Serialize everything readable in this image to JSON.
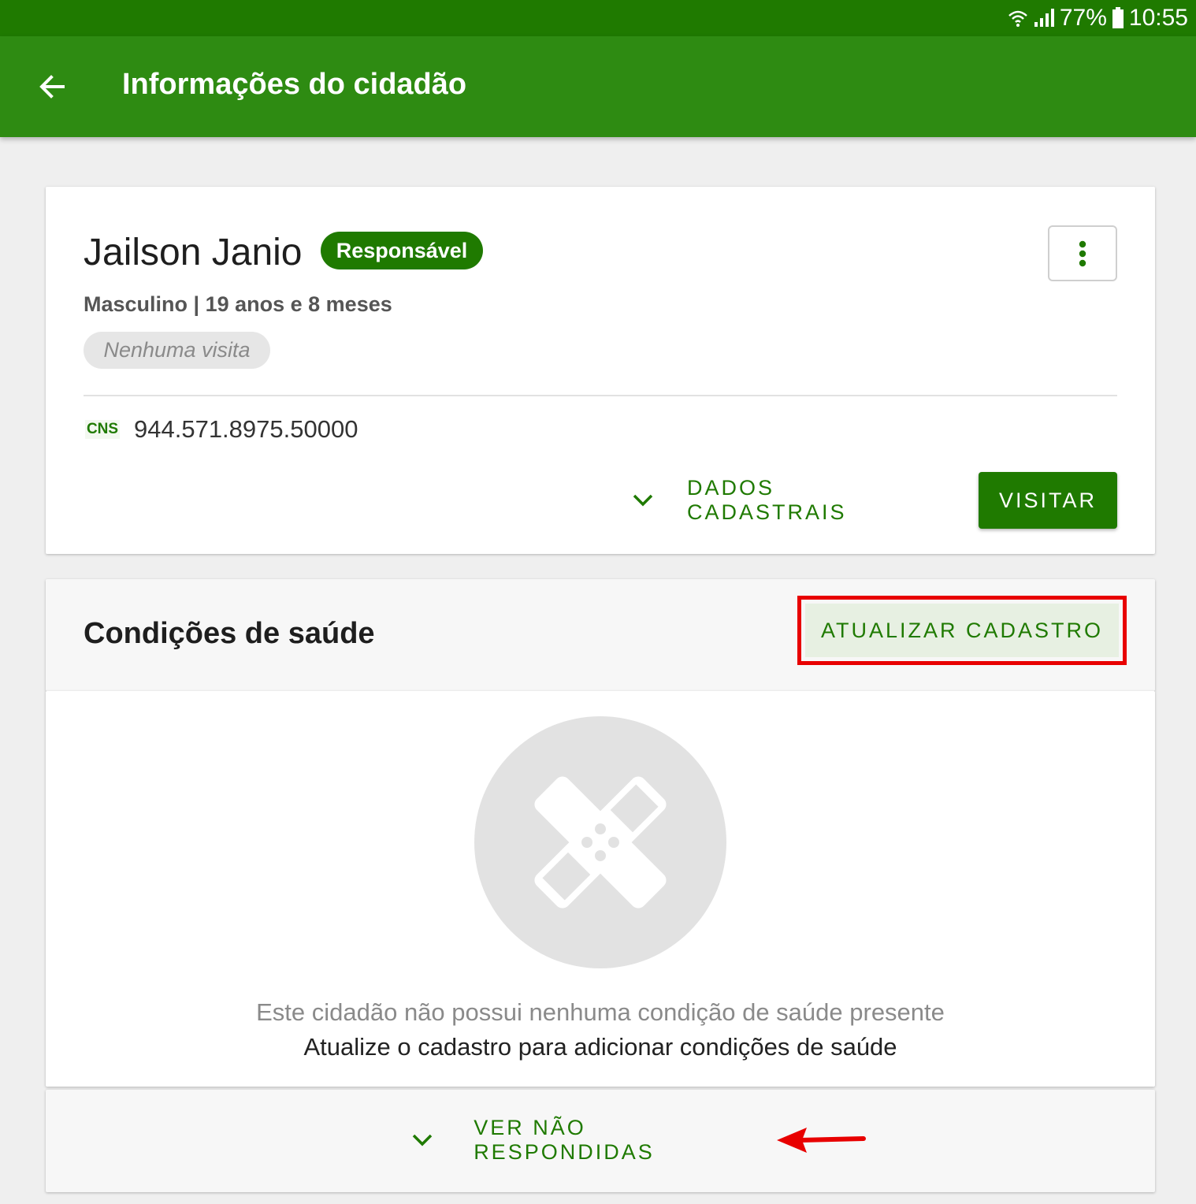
{
  "status_bar": {
    "battery": "77%",
    "time": "10:55",
    "icons": [
      "wifi-icon",
      "signal-icon",
      "battery-icon"
    ]
  },
  "app_bar": {
    "title": "Informações do cidadão",
    "back_icon": "arrow-left-icon"
  },
  "citizen": {
    "name": "Jailson Janio",
    "badge": "Responsável",
    "gender_age": "Masculino | 19 anos e 8 meses",
    "visit_status": "Nenhuma visita",
    "cns_label": "CNS",
    "cns_value": "944.571.8975.50000",
    "dados_button": "DADOS CADASTRAIS",
    "visitar_button": "VISITAR",
    "menu_icon": "more-vertical-icon"
  },
  "health": {
    "title": "Condições de saúde",
    "update_button": "ATUALIZAR CADASTRO",
    "empty_icon": "bandage-icon",
    "empty_line1": "Este cidadão não possui nenhuma condição de saúde presente",
    "empty_line2": "Atualize o cadastro para adicionar condições de saúde",
    "ver_button": "VER NÃO RESPONDIDAS"
  },
  "colors": {
    "primary": "#2e8b12",
    "primary_dark": "#1f7a00",
    "highlight": "#e80000"
  }
}
